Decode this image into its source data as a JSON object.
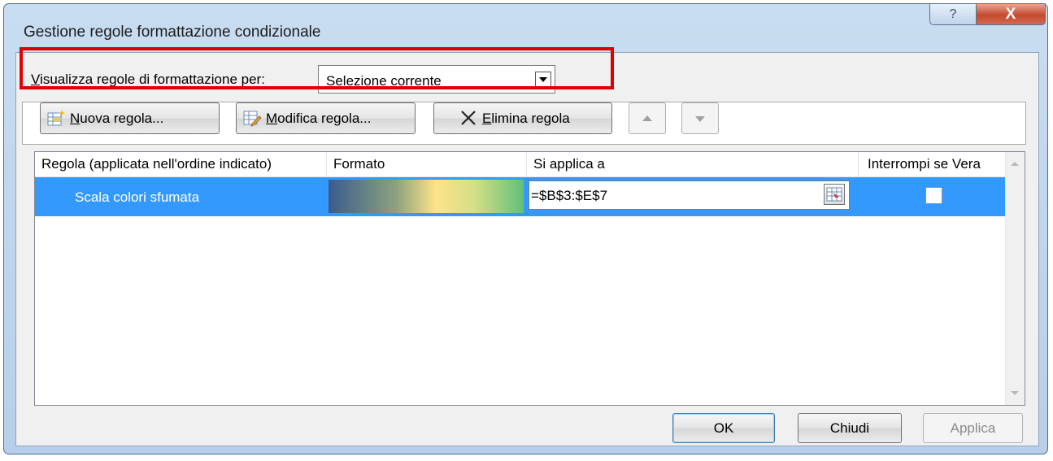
{
  "window": {
    "title": "Gestione regole formattazione condizionale",
    "help_glyph": "?",
    "close_glyph": "X"
  },
  "show_rules": {
    "label_accel": "V",
    "label_rest": "isualizza regole di formattazione per:",
    "value": "Selezione corrente"
  },
  "toolbar": {
    "new_rule": {
      "accel": "N",
      "rest": "uova regola..."
    },
    "edit_rule": {
      "accel": "M",
      "rest": "odifica regola..."
    },
    "delete_rule": {
      "accel": "E",
      "rest": "limina regola"
    }
  },
  "grid": {
    "headers": [
      "Regola (applicata nell'ordine indicato)",
      "Formato",
      "Si applica a",
      "Interrompi se Vera"
    ],
    "rows": [
      {
        "rule": "Scala colori sfumata",
        "applies_to": "=$B$3:$E$7",
        "stop_if_true": false,
        "selected": true,
        "format_gradient": [
          "#3b5b8c",
          "#fde38a",
          "#63bf7b"
        ]
      }
    ]
  },
  "footer": {
    "ok": "OK",
    "close": "Chiudi",
    "apply": "Applica"
  },
  "colors": {
    "selection": "#3399ff",
    "highlight_box": "#e00000"
  }
}
